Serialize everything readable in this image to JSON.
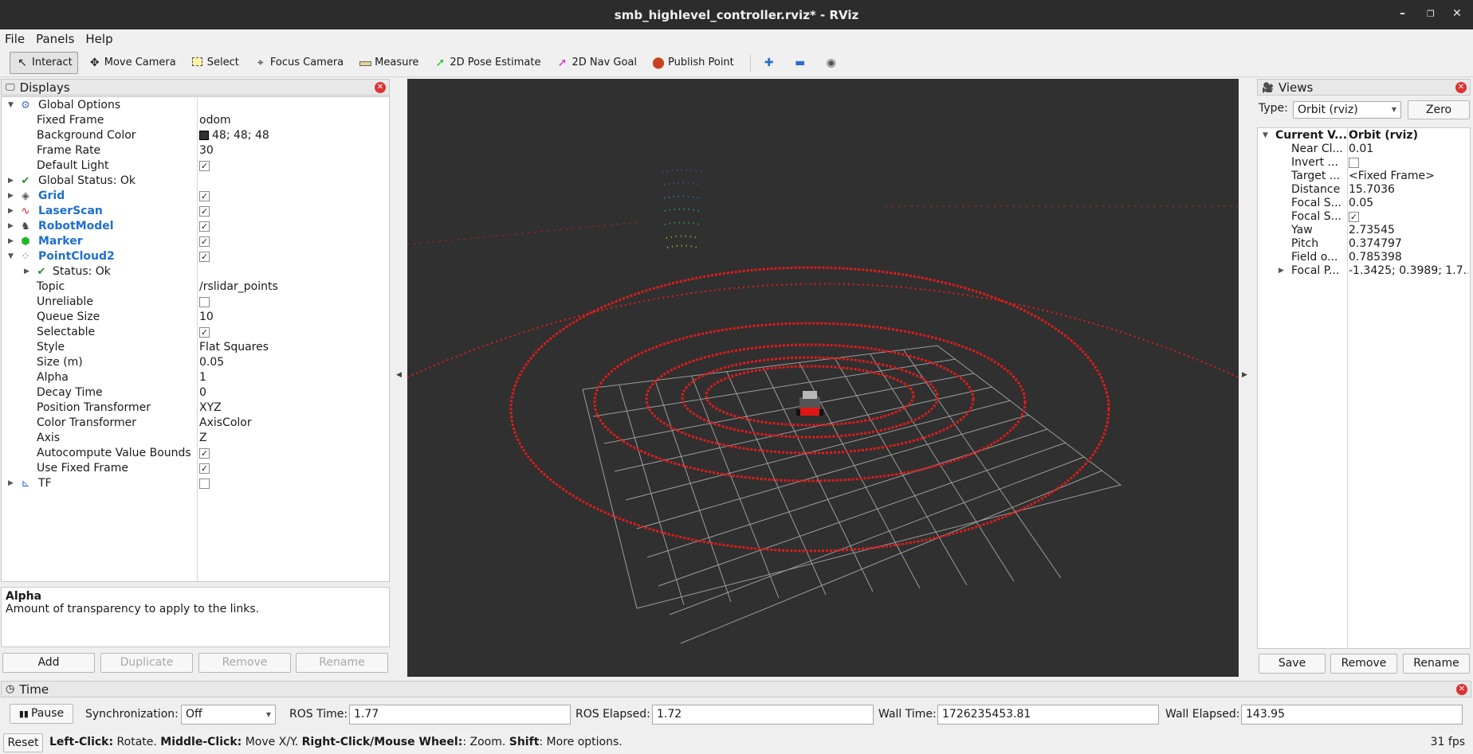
{
  "window": {
    "title": "smb_highlevel_controller.rviz* - RViz"
  },
  "menu": [
    "File",
    "Panels",
    "Help"
  ],
  "toolbar": {
    "interact": "Interact",
    "move_camera": "Move Camera",
    "select": "Select",
    "focus_camera": "Focus Camera",
    "measure": "Measure",
    "pose_estimate": "2D Pose Estimate",
    "nav_goal": "2D Nav Goal",
    "publish_point": "Publish Point"
  },
  "displays": {
    "title": "Displays",
    "global_options": "Global Options",
    "fixed_frame_label": "Fixed Frame",
    "fixed_frame": "odom",
    "bg_color_label": "Background Color",
    "bg_color": "48; 48; 48",
    "frame_rate_label": "Frame Rate",
    "frame_rate": "30",
    "default_light_label": "Default Light",
    "global_status": "Global Status: Ok",
    "grid": "Grid",
    "laserscan": "LaserScan",
    "robotmodel": "RobotModel",
    "marker": "Marker",
    "pointcloud2": "PointCloud2",
    "status_ok": "Status: Ok",
    "topic_label": "Topic",
    "topic": "/rslidar_points",
    "unreliable_label": "Unreliable",
    "queue_size_label": "Queue Size",
    "queue_size": "10",
    "selectable_label": "Selectable",
    "style_label": "Style",
    "style": "Flat Squares",
    "size_label": "Size (m)",
    "size": "0.05",
    "alpha_label": "Alpha",
    "alpha": "1",
    "decay_label": "Decay Time",
    "decay": "0",
    "pos_tf_label": "Position Transformer",
    "pos_tf": "XYZ",
    "color_tf_label": "Color Transformer",
    "color_tf": "AxisColor",
    "axis_label": "Axis",
    "axis": "Z",
    "autocompute_label": "Autocompute Value Bounds",
    "use_fixed_label": "Use Fixed Frame",
    "tf": "TF",
    "desc_title": "Alpha",
    "desc_text": "Amount of transparency to apply to the links.",
    "btn_add": "Add",
    "btn_duplicate": "Duplicate",
    "btn_remove": "Remove",
    "btn_rename": "Rename"
  },
  "views": {
    "title": "Views",
    "type_label": "Type:",
    "type_value": "Orbit (rviz)",
    "zero": "Zero",
    "current_label": "Current V...",
    "current_value": "Orbit (rviz)",
    "near_label": "Near Cl...",
    "near": "0.01",
    "invert_label": "Invert ...",
    "target_label": "Target ...",
    "target": "<Fixed Frame>",
    "distance_label": "Distance",
    "distance": "15.7036",
    "focal_size_label": "Focal S...",
    "focal_size": "0.05",
    "focal_shape_label": "Focal S...",
    "yaw_label": "Yaw",
    "yaw": "2.73545",
    "pitch_label": "Pitch",
    "pitch": "0.374797",
    "fov_label": "Field o...",
    "fov": "0.785398",
    "focal_point_label": "Focal P...",
    "focal_point": "-1.3425; 0.3989; 1.7...",
    "btn_save": "Save",
    "btn_remove": "Remove",
    "btn_rename": "Rename"
  },
  "time": {
    "title": "Time",
    "pause": "Pause",
    "sync_label": "Synchronization:",
    "sync": "Off",
    "ros_time_label": "ROS Time:",
    "ros_time": "1.77",
    "ros_elapsed_label": "ROS Elapsed:",
    "ros_elapsed": "1.72",
    "wall_time_label": "Wall Time:",
    "wall_time": "1726235453.81",
    "wall_elapsed_label": "Wall Elapsed:",
    "wall_elapsed": "143.95"
  },
  "status": {
    "reset": "Reset",
    "hint_b1": "Left-Click:",
    "hint_t1": " Rotate. ",
    "hint_b2": "Middle-Click:",
    "hint_t2": " Move X/Y. ",
    "hint_b3": "Right-Click/Mouse Wheel:",
    "hint_t3": ": Zoom. ",
    "hint_b4": "Shift",
    "hint_t4": ": More options.",
    "fps": "31 fps"
  }
}
